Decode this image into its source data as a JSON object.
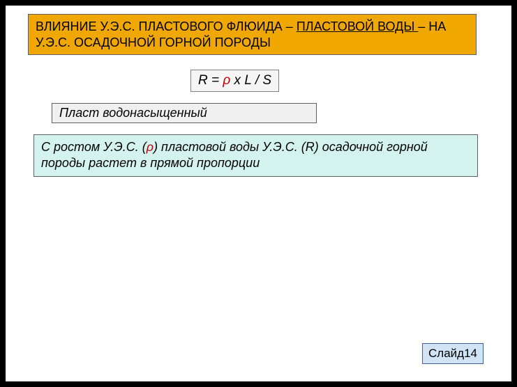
{
  "title": {
    "part1": "ВЛИЯНИЕ У.Э.С. ПЛАСТОВОГО ФЛЮИДА – ",
    "underlined": "ПЛАСТОВОЙ ВОДЫ ",
    "part2": "– НА У.Э.С. ОСАДОЧНОЙ ГОРНОЙ ПОРОДЫ"
  },
  "formula": {
    "pre": "R = ",
    "rho": "ρ",
    "post": " x L / S"
  },
  "label": "Пласт водонасыщенный",
  "description": {
    "pre": "С ростом У.Э.С. (",
    "rho": "ρ",
    "post": ") пластовой воды У.Э.С. (R) осадочной горной породы растет в прямой пропорции"
  },
  "slide_number": "Слайд14"
}
